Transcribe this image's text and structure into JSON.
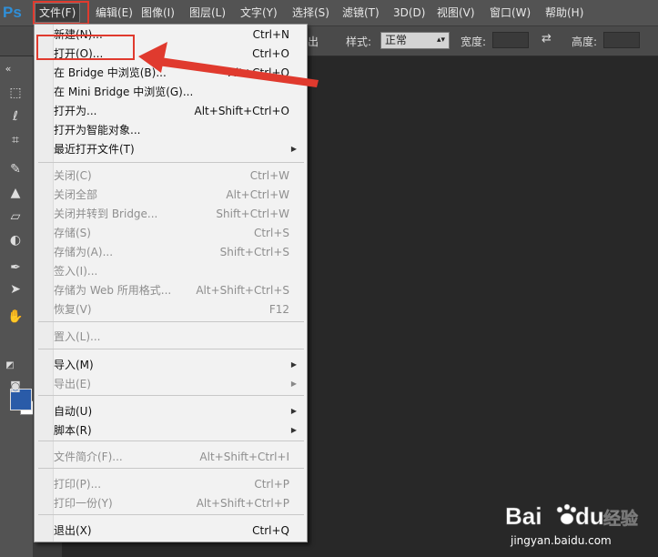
{
  "app": {
    "logo": "Ps"
  },
  "menubar": {
    "items": [
      "文件(F)",
      "编辑(E)",
      "图像(I)",
      "图层(L)",
      "文字(Y)",
      "选择(S)",
      "滤镜(T)",
      "3D(D)",
      "视图(V)",
      "窗口(W)",
      "帮助(H)"
    ]
  },
  "options": {
    "fragment": "出",
    "style_label": "样式:",
    "style_value": "正常",
    "width_label": "宽度:",
    "height_label": "高度:"
  },
  "file_menu": {
    "items": [
      {
        "label": "新建(N)...",
        "shortcut": "Ctrl+N",
        "enabled": true
      },
      {
        "label": "打开(O)...",
        "shortcut": "Ctrl+O",
        "enabled": true
      },
      {
        "label": "在 Bridge 中浏览(B)...",
        "shortcut": "Alt+Ctrl+O",
        "enabled": true
      },
      {
        "label": "在 Mini Bridge 中浏览(G)...",
        "shortcut": "",
        "enabled": true
      },
      {
        "label": "打开为...",
        "shortcut": "Alt+Shift+Ctrl+O",
        "enabled": true
      },
      {
        "label": "打开为智能对象...",
        "shortcut": "",
        "enabled": true
      },
      {
        "label": "最近打开文件(T)",
        "shortcut": "",
        "enabled": true,
        "submenu": true
      },
      {
        "label": "关闭(C)",
        "shortcut": "Ctrl+W",
        "enabled": false
      },
      {
        "label": "关闭全部",
        "shortcut": "Alt+Ctrl+W",
        "enabled": false
      },
      {
        "label": "关闭并转到 Bridge...",
        "shortcut": "Shift+Ctrl+W",
        "enabled": false
      },
      {
        "label": "存储(S)",
        "shortcut": "Ctrl+S",
        "enabled": false
      },
      {
        "label": "存储为(A)...",
        "shortcut": "Shift+Ctrl+S",
        "enabled": false
      },
      {
        "label": "签入(I)...",
        "shortcut": "",
        "enabled": false
      },
      {
        "label": "存储为 Web 所用格式...",
        "shortcut": "Alt+Shift+Ctrl+S",
        "enabled": false
      },
      {
        "label": "恢复(V)",
        "shortcut": "F12",
        "enabled": false
      },
      {
        "label": "置入(L)...",
        "shortcut": "",
        "enabled": false
      },
      {
        "label": "导入(M)",
        "shortcut": "",
        "enabled": true,
        "submenu": true
      },
      {
        "label": "导出(E)",
        "shortcut": "",
        "enabled": false,
        "submenu": true
      },
      {
        "label": "自动(U)",
        "shortcut": "",
        "enabled": true,
        "submenu": true
      },
      {
        "label": "脚本(R)",
        "shortcut": "",
        "enabled": true,
        "submenu": true
      },
      {
        "label": "文件简介(F)...",
        "shortcut": "Alt+Shift+Ctrl+I",
        "enabled": false
      },
      {
        "label": "打印(P)...",
        "shortcut": "Ctrl+P",
        "enabled": false
      },
      {
        "label": "打印一份(Y)",
        "shortcut": "Alt+Shift+Ctrl+P",
        "enabled": false
      },
      {
        "label": "退出(X)",
        "shortcut": "Ctrl+Q",
        "enabled": true
      }
    ]
  },
  "watermark": {
    "brand_a": "Bai",
    "brand_b": "du",
    "brand_cn": "经验",
    "url": "jingyan.baidu.com"
  },
  "colors": {
    "annotation": "#e03a2e",
    "foreground": "#2a5ba8",
    "background": "#ffffff"
  }
}
